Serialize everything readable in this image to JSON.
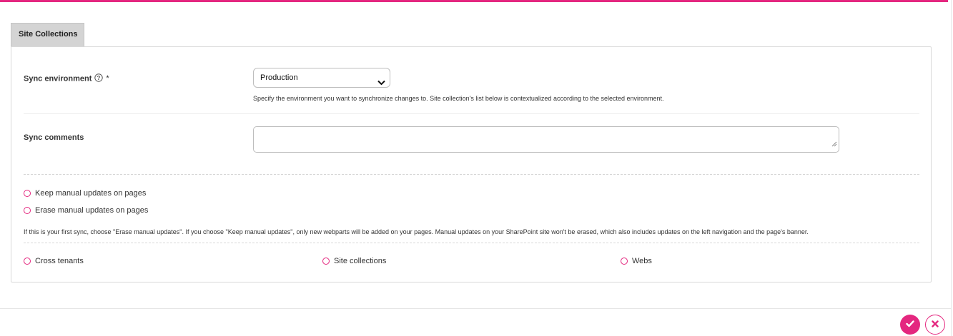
{
  "tab": {
    "label": "Site Collections"
  },
  "sync_environment": {
    "label": "Sync environment",
    "required_mark": "*",
    "selected": "Production",
    "hint": "Specify the environment you want to synchronize changes to. Site collection's list below is contextualized according to the selected environment."
  },
  "sync_comments": {
    "label": "Sync comments",
    "value": ""
  },
  "update_mode": {
    "options": [
      "Keep manual updates on pages",
      "Erase manual updates on pages"
    ],
    "hint": "If this is your first sync, choose \"Erase manual updates\". If you choose \"Keep manual updates\", only new webparts will be added on your pages. Manual updates on your SharePoint site won't be erased, which also includes updates on the left navigation and the page's banner."
  },
  "scope": {
    "options": [
      "Cross tenants",
      "Site collections",
      "Webs"
    ]
  },
  "footer": {
    "confirm_icon": "check-icon",
    "cancel_icon": "close-icon"
  },
  "colors": {
    "accent": "#e4277f",
    "tab_bg": "#d4d4d4",
    "border": "#d9d9d9"
  }
}
